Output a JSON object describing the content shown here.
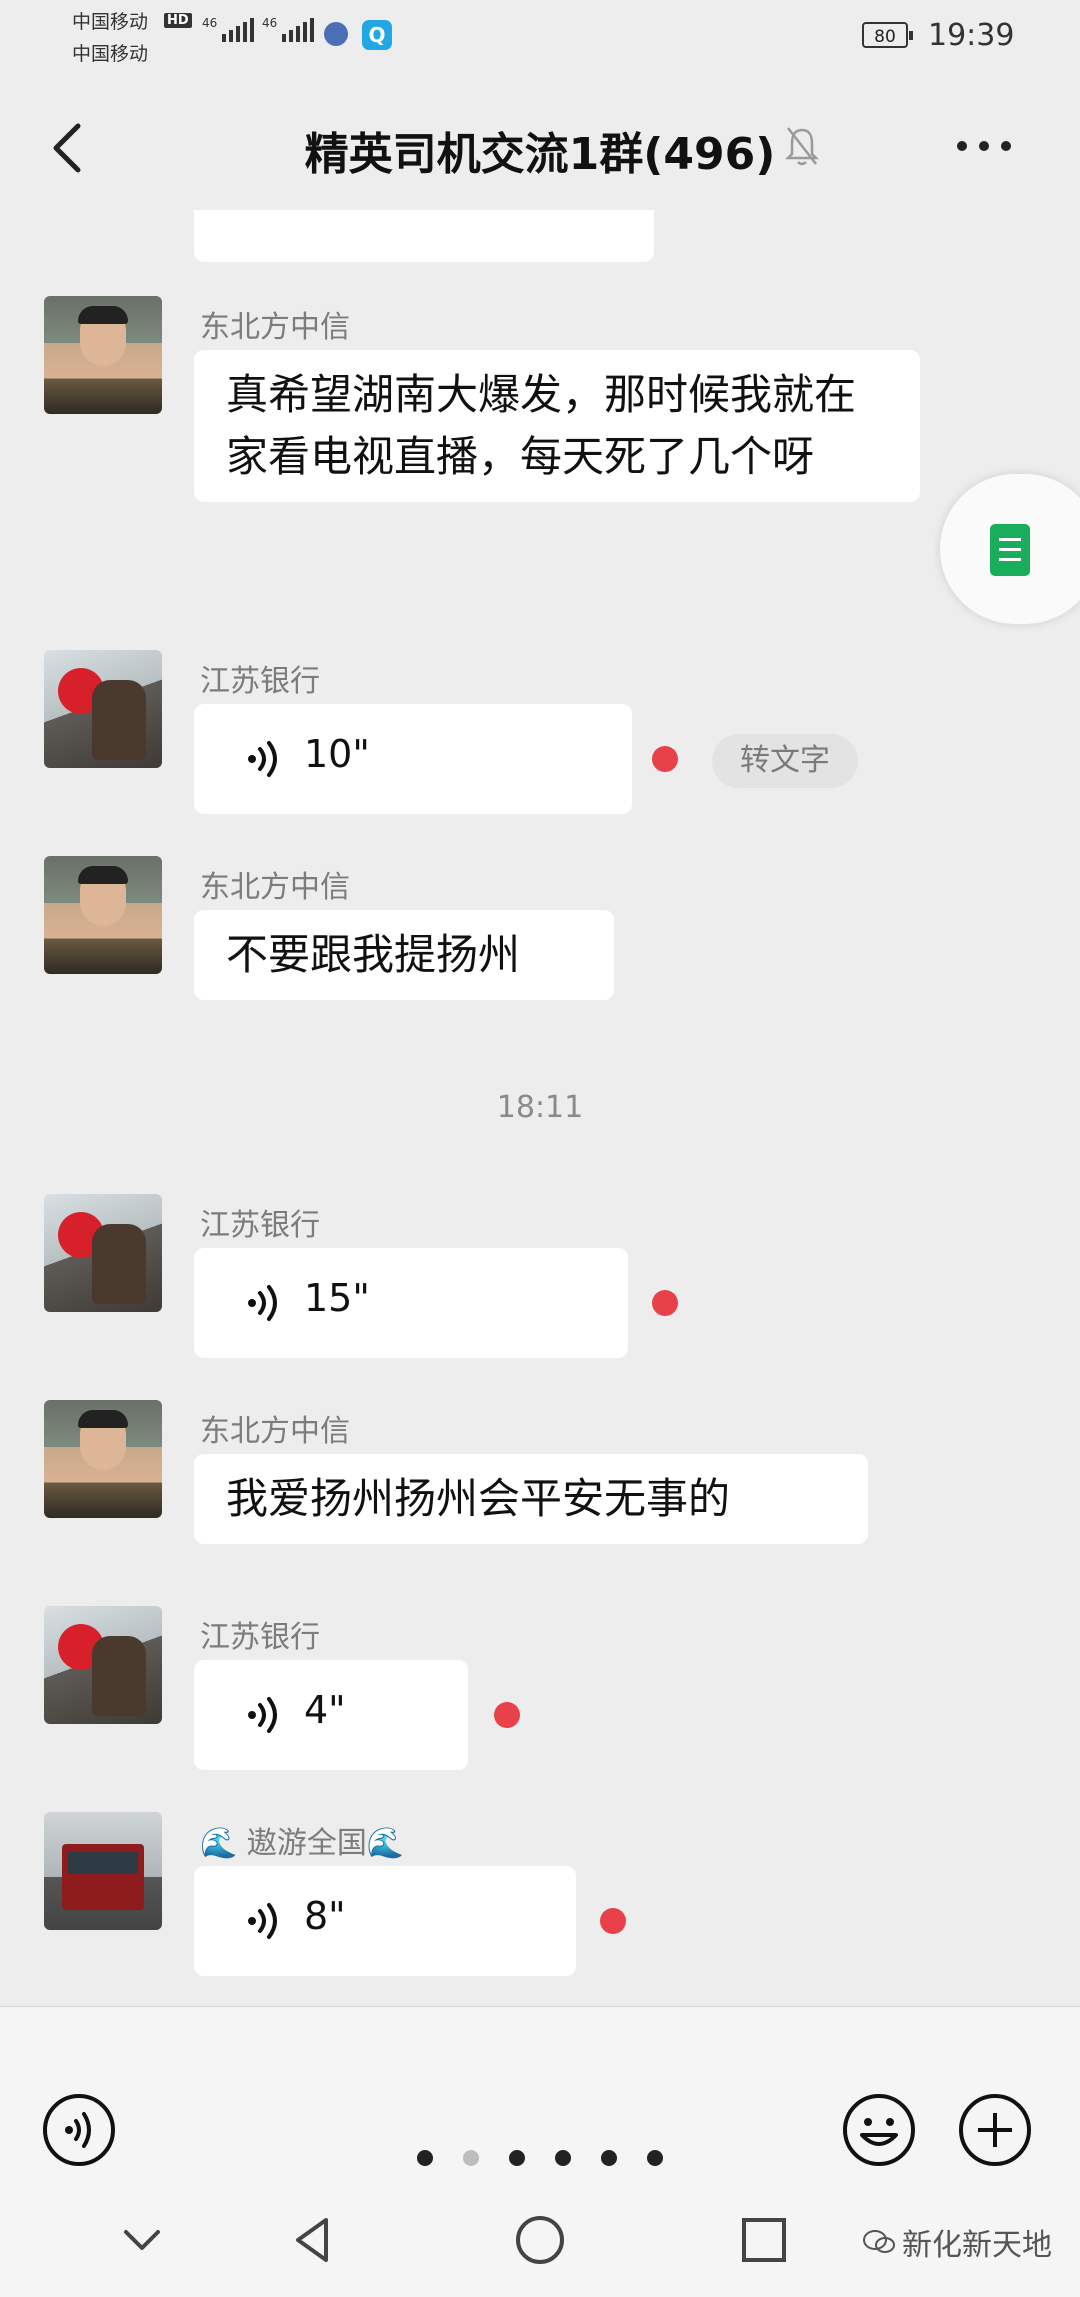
{
  "status_bar": {
    "carrier_1": "中国移动",
    "carrier_2": "中国移动",
    "hd": "HD",
    "signal_label_1": "46",
    "signal_label_2": "46",
    "qapp_glyph": "Q",
    "battery": "80",
    "time": "19:39"
  },
  "header": {
    "title": "精英司机交流1群(496)",
    "back_icon": "chevron-left-icon",
    "mute_icon": "bell-off-icon",
    "more_icon": "ellipsis-icon"
  },
  "messages": [
    {
      "sender": "东北方中信",
      "type": "text",
      "text": "真希望湖南大爆发，那时候我就在家看电视直播，每天死了几个呀"
    },
    {
      "sender": "江苏银行",
      "type": "voice",
      "duration": "10\"",
      "unread": true,
      "transcribe_label": "转文字"
    },
    {
      "sender": "东北方中信",
      "type": "text",
      "text": "不要跟我提扬州"
    },
    {
      "type": "timestamp",
      "text": "18:11"
    },
    {
      "sender": "江苏银行",
      "type": "voice",
      "duration": "15\"",
      "unread": true
    },
    {
      "sender": "东北方中信",
      "type": "text",
      "text": "我爱扬州扬州会平安无事的"
    },
    {
      "sender": "江苏银行",
      "type": "voice",
      "duration": "4\"",
      "unread": true
    },
    {
      "sender": "🌊 遨游全国🌊",
      "type": "voice",
      "duration": "8\"",
      "unread": true
    }
  ],
  "input_bar": {
    "voice_icon": "voice-input-icon",
    "emoji_icon": "emoji-icon",
    "plus_icon": "plus-icon",
    "page_dots_count": 6,
    "active_dot_index": 1
  },
  "nav_bar": {
    "down_icon": "chevron-down-icon",
    "back_icon": "triangle-back-icon",
    "home_icon": "circle-home-icon",
    "recent_icon": "square-recent-icon",
    "watermark": "新化新天地"
  },
  "colors": {
    "background": "#ededed",
    "bubble": "#ffffff",
    "unread_dot": "#e9414a",
    "doc_green": "#1aad5b"
  }
}
